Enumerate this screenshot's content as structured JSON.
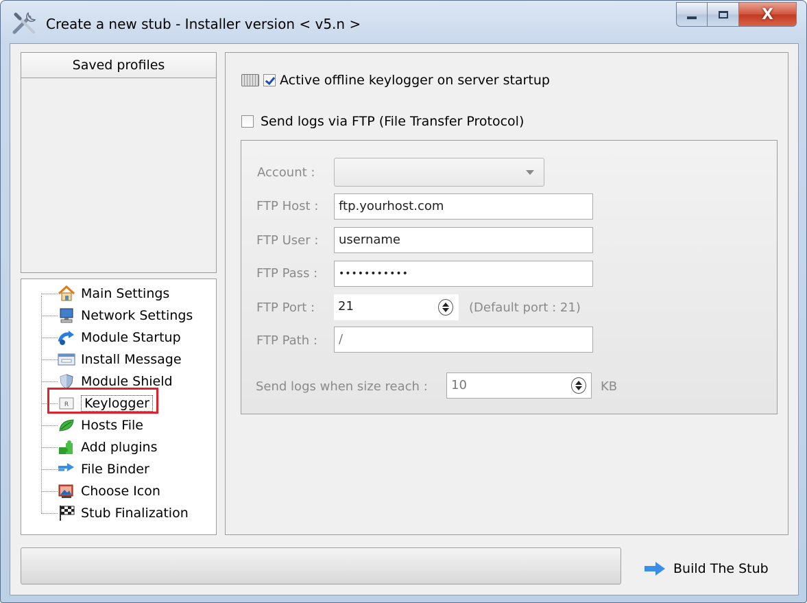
{
  "window": {
    "title": "Create a new stub - Installer version < v5.n >"
  },
  "caption_buttons": {
    "minimize": "",
    "maximize": "",
    "close": "X"
  },
  "saved_profiles": {
    "header": "Saved profiles",
    "items": []
  },
  "tree": {
    "items": [
      {
        "label": "Main Settings",
        "icon": "house-icon"
      },
      {
        "label": "Network Settings",
        "icon": "monitor-icon"
      },
      {
        "label": "Module Startup",
        "icon": "startup-arrow-icon"
      },
      {
        "label": "Install Message",
        "icon": "message-box-icon"
      },
      {
        "label": "Module Shield",
        "icon": "shield-icon"
      },
      {
        "label": "Keylogger",
        "icon": "keylogger-icon",
        "selected": true
      },
      {
        "label": "Hosts File",
        "icon": "leaf-icon"
      },
      {
        "label": "Add plugins",
        "icon": "puzzle-icon"
      },
      {
        "label": "File Binder",
        "icon": "double-arrow-icon"
      },
      {
        "label": "Choose Icon",
        "icon": "picture-icon"
      },
      {
        "label": "Stub Finalization",
        "icon": "checkered-flag-icon"
      }
    ]
  },
  "keylogger": {
    "active_offline_label": "Active offline keylogger on server startup",
    "active_offline_checked": true,
    "send_ftp_label": "Send logs via FTP (File Transfer Protocol)",
    "send_ftp_checked": false,
    "account_label": "Account :",
    "account_value": "",
    "host_label": "FTP Host :",
    "host_value": "ftp.yourhost.com",
    "user_label": "FTP User :",
    "user_value": "username",
    "pass_label": "FTP Pass :",
    "pass_value": "•••••••••••",
    "port_label": "FTP Port :",
    "port_value": "21",
    "port_hint": "(Default port : 21)",
    "path_label": "FTP Path :",
    "path_value": "/",
    "size_label": "Send logs when size reach :",
    "size_value": "10",
    "size_unit": "KB"
  },
  "footer": {
    "build_label": "Build The Stub"
  },
  "colors": {
    "highlight": "#e0202a",
    "checkmark": "#1a4cb8"
  }
}
